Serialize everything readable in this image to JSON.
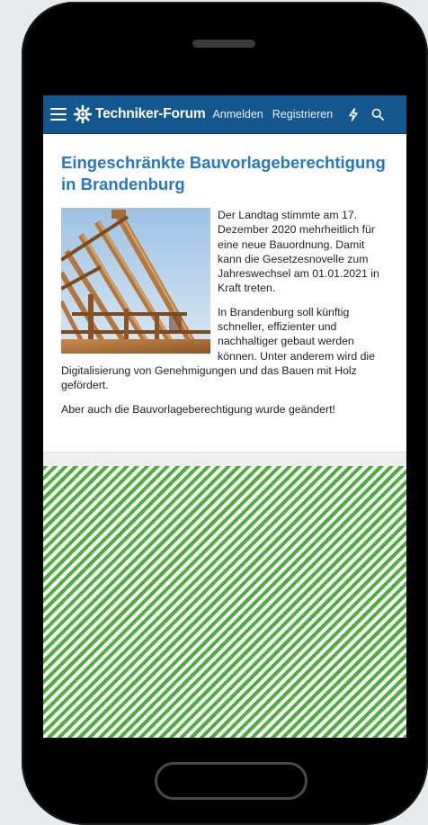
{
  "header": {
    "brand": "Techniker-Forum",
    "login_label": "Anmelden",
    "register_label": "Registrieren"
  },
  "icons": {
    "menu": "hamburger-menu-icon",
    "logo": "gear-logo-icon",
    "whats_new": "lightning-bolt-icon",
    "search": "search-icon"
  },
  "colors": {
    "navbar": "#14578f",
    "title": "#2577c8",
    "ad_stripe": "#4caf3a"
  },
  "article": {
    "title": "Eingeschränkte Bauvorlageberechtigung in Brandenburg",
    "paragraphs": [
      "Der Landtag stimmte am 17. Dezember 2020 mehrheitlich für eine neue Bauordnung. Damit kann die Gesetzesnovelle zum Jahreswechsel am 01.01.2021 in Kraft treten.",
      "In Brandenburg soll künftig schneller, effizienter und nachhaltiger gebaut werden können. Unter anderem wird die Digitalisierung von Genehmigungen und das Bauen mit Holz gefördert.",
      "Aber auch die Bauvorlageberechtigung wurde geändert!"
    ]
  }
}
